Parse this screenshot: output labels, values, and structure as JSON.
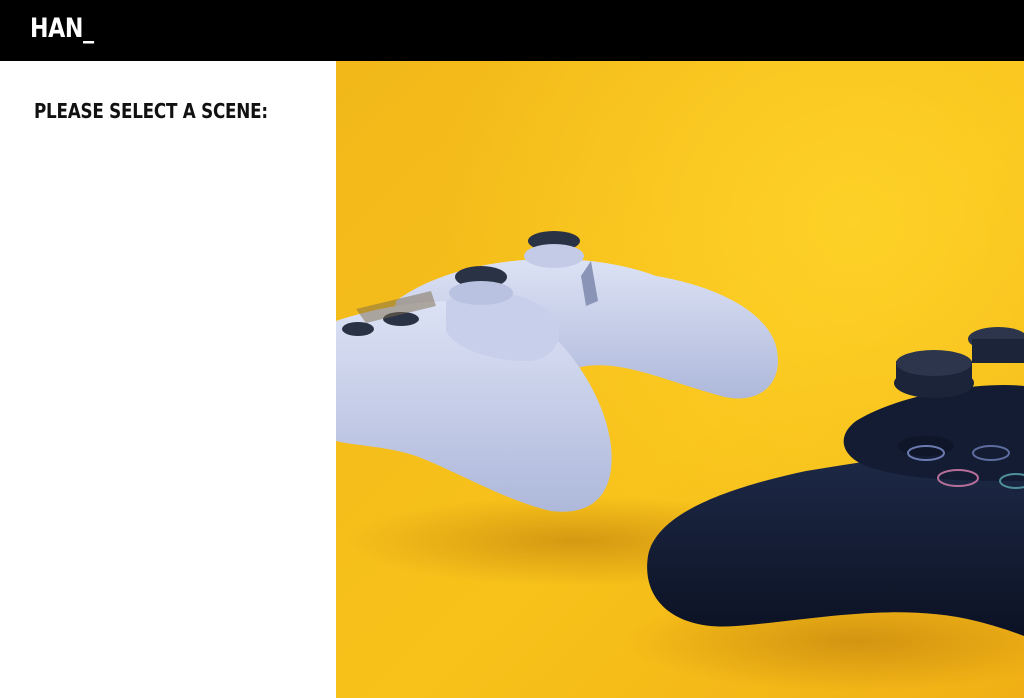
{
  "header": {
    "logo_text": "HAN_"
  },
  "sidebar": {
    "prompt": "PLEASE SELECT A SCENE:"
  },
  "scene": {
    "image_description_icon": "game-controllers-photo",
    "background_color": "#F6BF18",
    "white_controller_color": "#C9D2EC",
    "black_controller_color": "#121A2E"
  }
}
